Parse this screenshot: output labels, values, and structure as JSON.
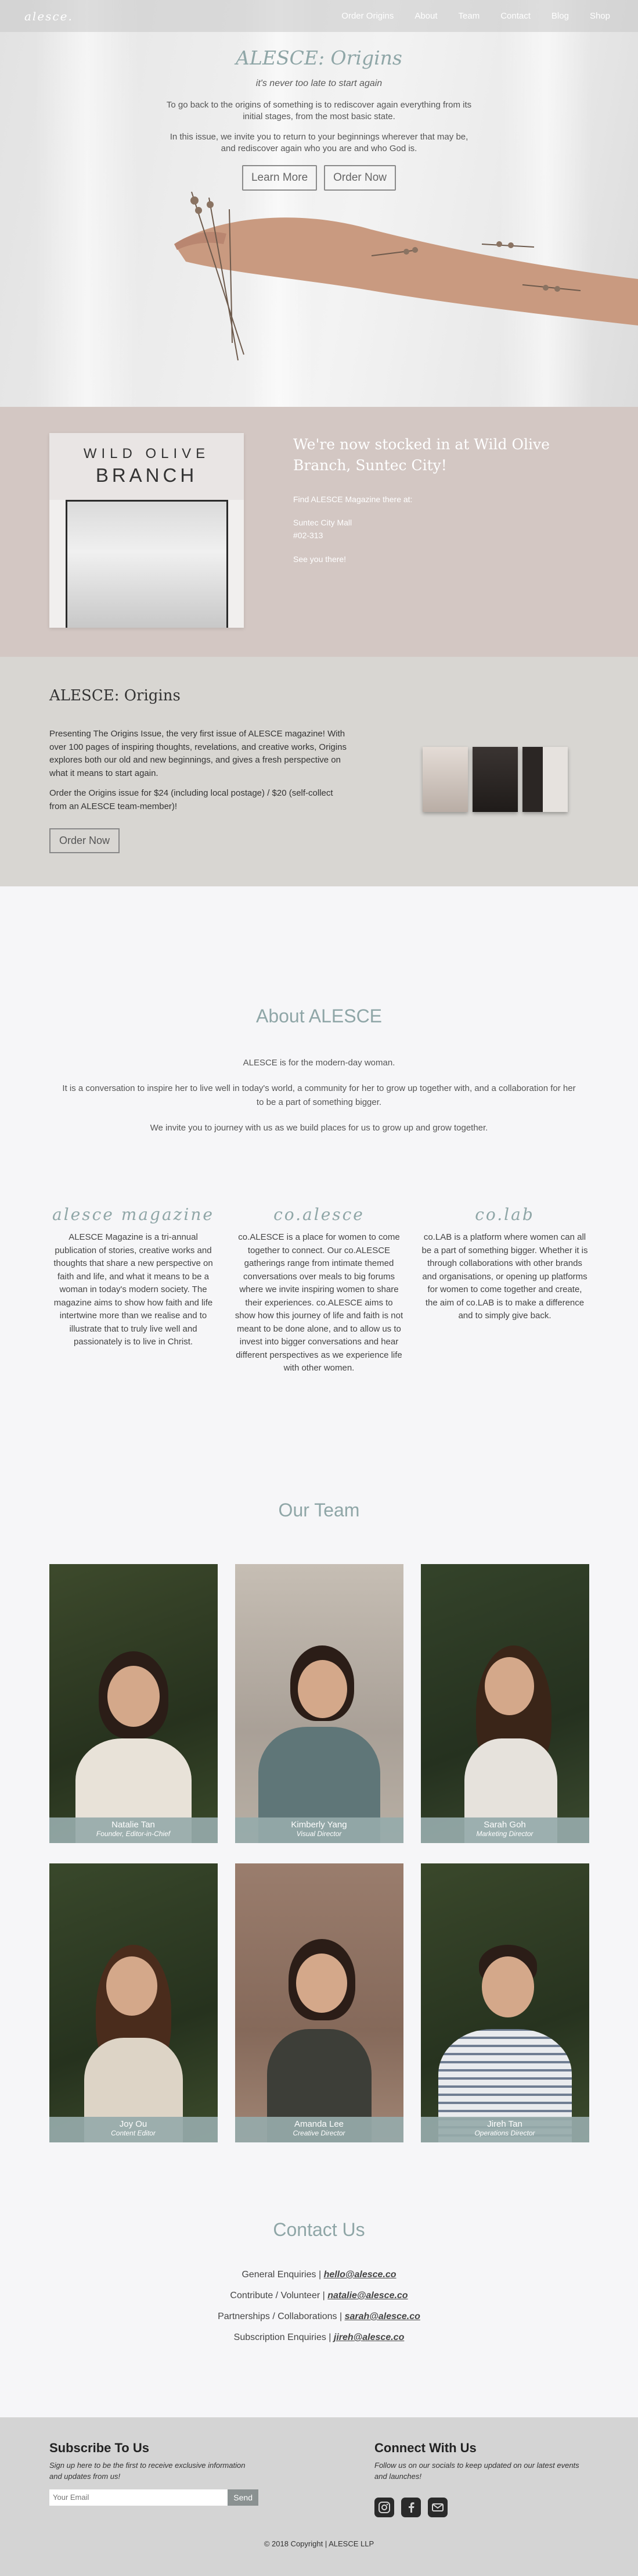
{
  "nav": {
    "logo": "alesce.",
    "links": [
      "Order Origins",
      "About",
      "Team",
      "Contact",
      "Blog",
      "Shop"
    ]
  },
  "hero": {
    "title": "ALESCE: Origins",
    "subtitle": "it's never too late to start again",
    "p1": "To go back to the origins of something is to rediscover again everything from its initial stages, from the most basic state.",
    "p2": "In this issue, we invite you to return to your beginnings wherever that may be, and rediscover again who you are and who God is.",
    "btn_learn": "Learn More",
    "btn_order": "Order Now"
  },
  "stocked": {
    "sign_line1": "WILD OLIVE",
    "sign_line2": "BRANCH",
    "heading": "We're now stocked in at Wild Olive Branch, Suntec City!",
    "find": "Find ALESCE Magazine there at:",
    "address1": "Suntec City Mall",
    "address2": "#02-313",
    "see": "See you there!"
  },
  "origins": {
    "title": "ALESCE: Origins",
    "p1": "Presenting The Origins Issue, the very first issue of ALESCE magazine! With over 100 pages of inspiring thoughts, revelations, and creative works, Origins explores both our old and new beginnings, and gives a fresh perspective on what it means to start again.",
    "p2": "Order the Origins issue for $24 (including local postage) / $20 (self-collect from an ALESCE team-member)!",
    "btn": "Order Now"
  },
  "about": {
    "title": "About ALESCE",
    "p1": "ALESCE is for the modern-day woman.",
    "p2": "It is a conversation to inspire her to live well in today's world, a community for her to grow up together with, and a collaboration for her to be a part of something bigger.",
    "p3": "We invite you to journey with us as we build places for us to grow up and grow together.",
    "pillars": [
      {
        "title": "alesce magazine",
        "text": "ALESCE Magazine is a tri-annual publication of stories, creative works and thoughts that share a new perspective on faith and life, and what it means to be a woman in today's modern society. The magazine aims to show how faith and life intertwine more than we realise and to illustrate that to truly live well and passionately is to live in Christ."
      },
      {
        "title": "co.alesce",
        "text": "co.ALESCE is a place for women to come together to connect. Our co.ALESCE gatherings range from intimate themed conversations over meals to big forums where we invite inspiring women to share their experiences. co.ALESCE aims to show how this journey of life and faith is not meant to be done alone, and to allow us to invest into bigger conversations and hear different perspectives as we experience life with other women."
      },
      {
        "title": "co.lab",
        "text": "co.LAB is a platform where women can all be a part of something bigger. Whether it is through collaborations with other brands and organisations, or opening up platforms for women to come together and create, the aim of co.LAB is to make a difference and to simply give back."
      }
    ]
  },
  "team": {
    "title": "Our Team",
    "members": [
      {
        "name": "Natalie Tan",
        "role": "Founder, Editor-in-Chief"
      },
      {
        "name": "Kimberly Yang",
        "role": "Visual Director"
      },
      {
        "name": "Sarah Goh",
        "role": "Marketing Director"
      },
      {
        "name": "Joy Ou",
        "role": "Content Editor"
      },
      {
        "name": "Amanda Lee",
        "role": "Creative Director"
      },
      {
        "name": "Jireh Tan",
        "role": "Operations Director"
      }
    ]
  },
  "contact": {
    "title": "Contact Us",
    "rows": [
      {
        "label": "General Enquiries |",
        "email": "hello@alesce.co"
      },
      {
        "label": "Contribute / Volunteer |",
        "email": "natalie@alesce.co"
      },
      {
        "label": "Partnerships / Collaborations |",
        "email": "sarah@alesce.co"
      },
      {
        "label": "Subscription Enquiries |",
        "email": "jireh@alesce.co"
      }
    ]
  },
  "footer": {
    "subscribe_title": "Subscribe To Us",
    "subscribe_text": "Sign up here to be the first to receive exclusive information and updates from us!",
    "email_placeholder": "Your Email",
    "send": "Send",
    "connect_title": "Connect With Us",
    "connect_text": "Follow us on our socials to keep updated on our latest events and launches!",
    "copyright": "© 2018 Copyright | ALESCE LLP"
  }
}
